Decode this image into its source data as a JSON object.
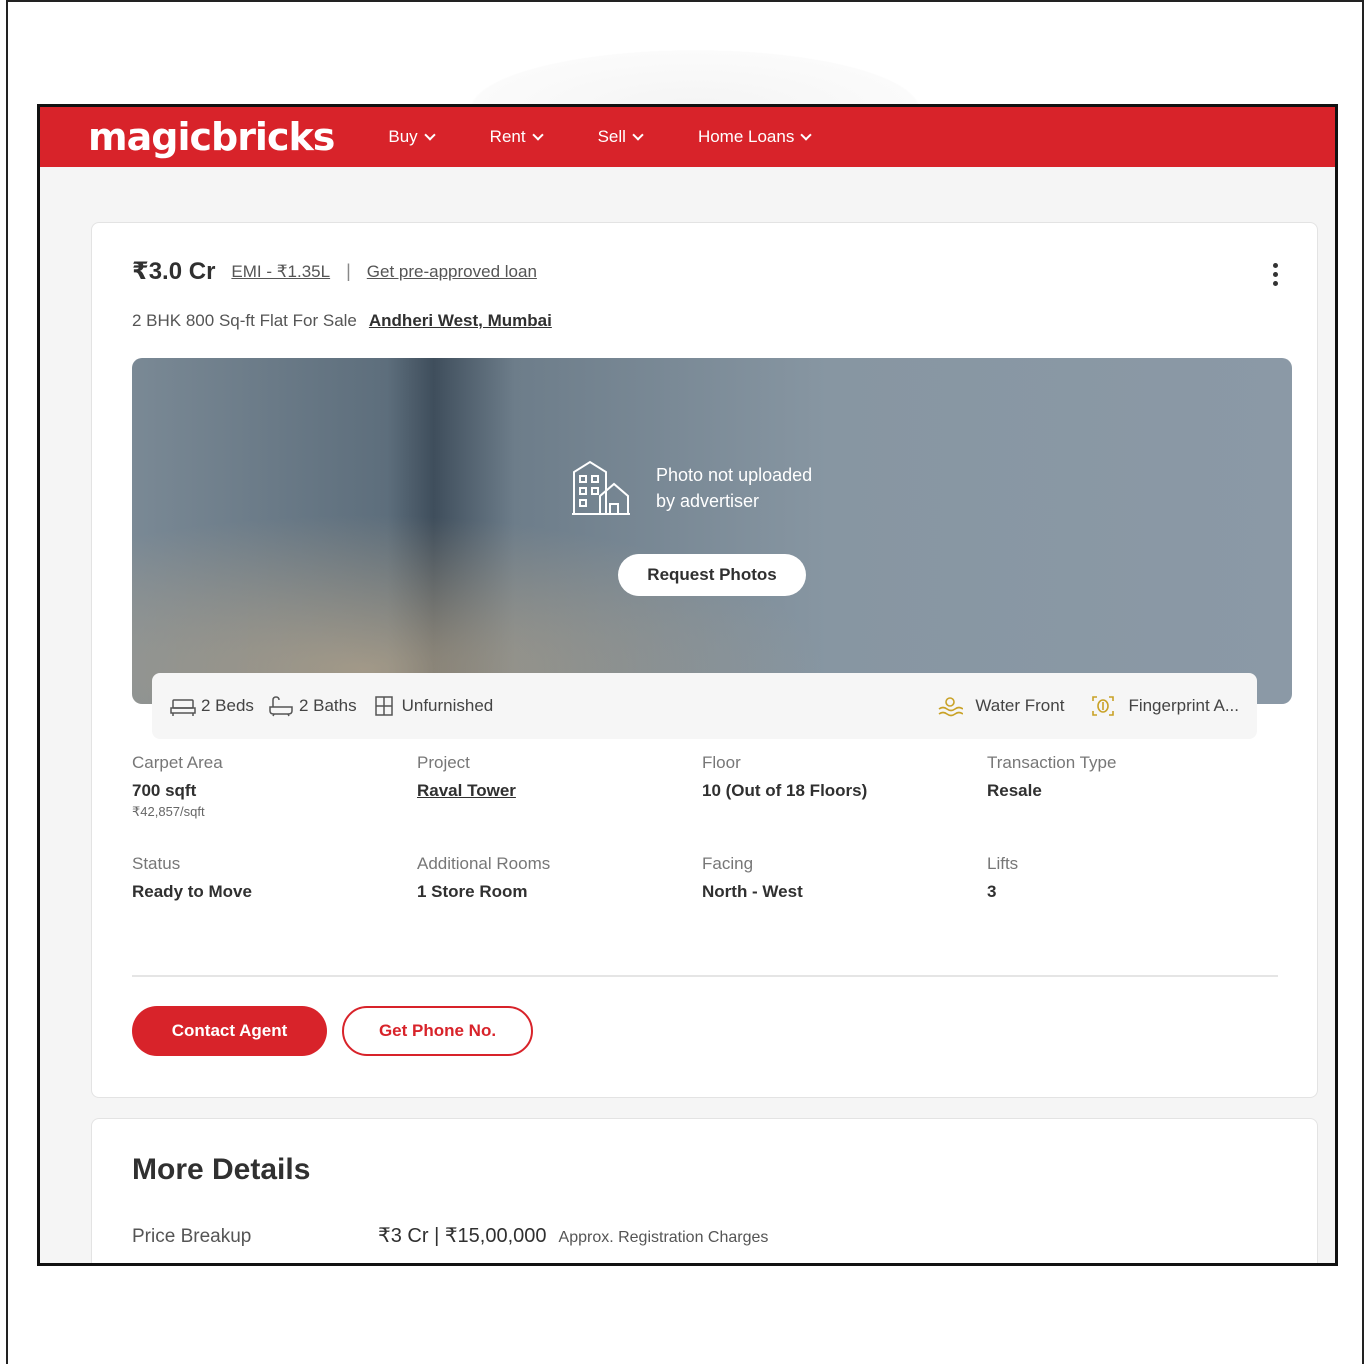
{
  "nav": {
    "logo": "magicbricks",
    "items": [
      {
        "label": "Buy"
      },
      {
        "label": "Rent"
      },
      {
        "label": "Sell"
      },
      {
        "label": "Home Loans"
      }
    ]
  },
  "listing": {
    "price": "₹3.0 Cr",
    "emi": "EMI - ₹1.35L",
    "separator": "|",
    "loan_link": "Get pre-approved loan",
    "subtitle": "2 BHK 800 Sq-ft Flat For Sale",
    "locality": "Andheri West, Mumbai",
    "photo_message_line1": "Photo not uploaded",
    "photo_message_line2": "by advertiser",
    "request_button": "Request Photos",
    "amenities_left": [
      {
        "icon": "bed-icon",
        "label": "2 Beds"
      },
      {
        "icon": "bath-icon",
        "label": "2 Baths"
      },
      {
        "icon": "furnishing-icon",
        "label": "Unfurnished"
      }
    ],
    "amenities_right": [
      {
        "icon": "water-front-icon",
        "label": "Water Front"
      },
      {
        "icon": "fingerprint-icon",
        "label": "Fingerprint A..."
      }
    ],
    "specs": {
      "carpet_area": {
        "label": "Carpet Area",
        "value": "700 sqft",
        "sub": "₹42,857/sqft"
      },
      "project": {
        "label": "Project",
        "value": "Raval Tower"
      },
      "floor": {
        "label": "Floor",
        "value": "10 (Out of 18 Floors)"
      },
      "transaction": {
        "label": "Transaction Type",
        "value": "Resale"
      },
      "status": {
        "label": "Status",
        "value": "Ready to Move"
      },
      "additional_rooms": {
        "label": "Additional Rooms",
        "value": "1 Store Room"
      },
      "facing": {
        "label": "Facing",
        "value": "North - West"
      },
      "lifts": {
        "label": "Lifts",
        "value": "3"
      }
    },
    "contact_button": "Contact Agent",
    "phone_button": "Get Phone No."
  },
  "more_details": {
    "title": "More Details",
    "price_breakup_label": "Price Breakup",
    "price_breakup_value": "₹3 Cr | ₹15,00,000",
    "price_breakup_note": "Approx. Registration Charges"
  },
  "colors": {
    "brand_red": "#d8232a"
  }
}
